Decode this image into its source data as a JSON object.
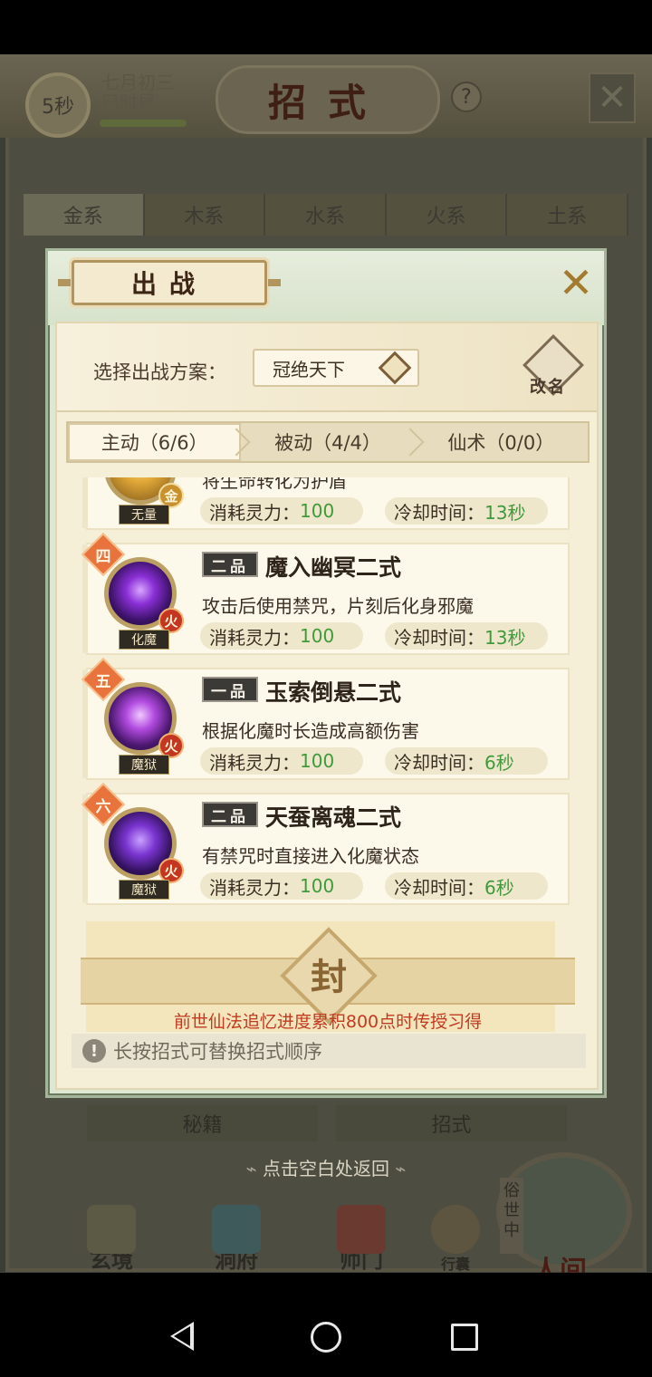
{
  "background": {
    "timer": "5秒",
    "date_line1": "七月初三",
    "date_line2": "巳时昼",
    "title": "招式",
    "help_icon": "?",
    "tabs": [
      "金系",
      "木系",
      "水系",
      "火系",
      "土系"
    ],
    "bottom_tabs": [
      "秘籍",
      "招式"
    ],
    "return_hint": "点击空白处返回",
    "nav": [
      "玄境",
      "洞府",
      "师门"
    ],
    "pack_label": "行囊",
    "world_tag": "俗世中",
    "world_label": "人间"
  },
  "modal": {
    "title": "出战",
    "scheme_label": "选择出战方案：",
    "scheme_value": "冠绝天下",
    "rename_label": "改名",
    "tabs": [
      {
        "label": "主动（6/6）",
        "selected": true
      },
      {
        "label": "被动（4/4）",
        "selected": false
      },
      {
        "label": "仙术（0/0）",
        "selected": false
      }
    ],
    "skills": [
      {
        "order": "",
        "orb_name": "无量",
        "element": "金",
        "grade": "",
        "name": "",
        "desc": "将生命转化为护盾",
        "cost_label": "消耗灵力：",
        "cost": "100",
        "cd_label": "冷却时间：",
        "cd": "13秒"
      },
      {
        "order": "四",
        "orb_name": "化魔",
        "element": "火",
        "grade": "二品",
        "name": "魔入幽冥二式",
        "desc": "攻击后使用禁咒，片刻后化身邪魔",
        "cost_label": "消耗灵力：",
        "cost": "100",
        "cd_label": "冷却时间：",
        "cd": "13秒"
      },
      {
        "order": "五",
        "orb_name": "魔狱",
        "element": "火",
        "grade": "一品",
        "name": "玉索倒悬二式",
        "desc": "根据化魔时长造成高额伤害",
        "cost_label": "消耗灵力：",
        "cost": "100",
        "cd_label": "冷却时间：",
        "cd": "6秒"
      },
      {
        "order": "六",
        "orb_name": "魔狱",
        "element": "火",
        "grade": "二品",
        "name": "天蚕离魂二式",
        "desc": "有禁咒时直接进入化魔状态",
        "cost_label": "消耗灵力：",
        "cost": "100",
        "cd_label": "冷却时间：",
        "cd": "6秒"
      }
    ],
    "sealed_char": "封",
    "sealed_condition": "前世仙法追忆进度累积800点时传授习得",
    "tip": "长按招式可替换招式顺序"
  }
}
